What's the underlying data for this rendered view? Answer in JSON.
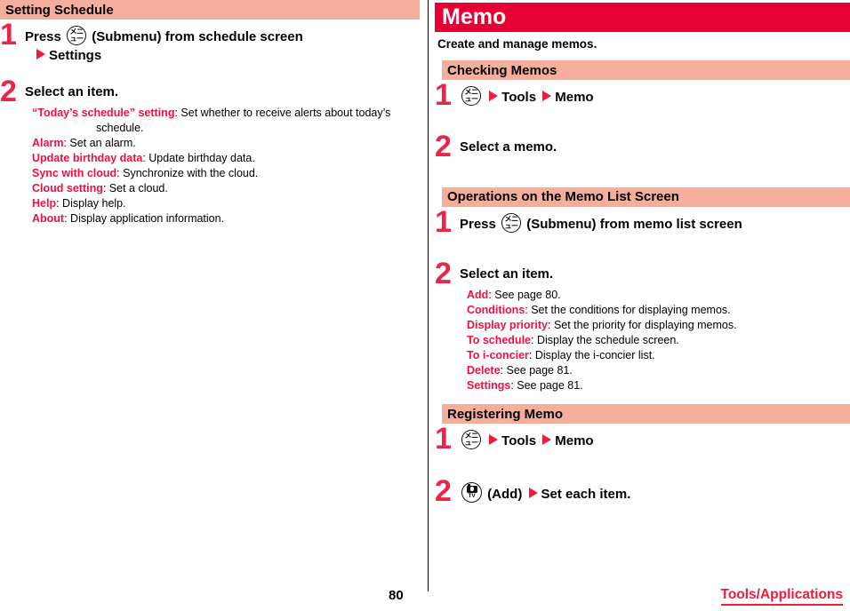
{
  "document": {
    "page_number": "80",
    "chapter_footer": "Tools/Applications"
  },
  "left_column": {
    "section_header": "Setting Schedule",
    "steps": [
      {
        "number": "1",
        "text_before_icon": "Press",
        "icon": "menu-key-icon",
        "icon_glyph": "メニュー",
        "text_after_icon": "(Submenu) from schedule screen",
        "sub_line_marker": "triangle-right-icon",
        "sub_line": "Settings"
      },
      {
        "number": "2",
        "title": "Select an item.",
        "items": [
          {
            "term": "“Today’s schedule” setting",
            "desc": ": Set whether to receive alerts about today’s",
            "cont": "schedule."
          },
          {
            "term": "Alarm",
            "desc": ": Set an alarm.",
            "cont": ""
          },
          {
            "term": "Update birthday data",
            "desc": ": Update birthday data.",
            "cont": ""
          },
          {
            "term": "Sync with cloud",
            "desc": ": Synchronize with the cloud.",
            "cont": ""
          },
          {
            "term": "Cloud setting",
            "desc": ": Set a cloud.",
            "cont": ""
          },
          {
            "term": "Help",
            "desc": ": Display help.",
            "cont": ""
          },
          {
            "term": "About",
            "desc": ": Display application information.",
            "cont": ""
          }
        ]
      }
    ]
  },
  "right_column": {
    "chapter_title": "Memo",
    "chapter_description": "Create and manage memos.",
    "sections": [
      {
        "header": "Checking Memos",
        "steps": [
          {
            "number": "1",
            "icon": "menu-key-icon",
            "icon_glyph": "メニュー",
            "nav_1": "Tools",
            "nav_2": "Memo"
          },
          {
            "number": "2",
            "title": "Select a memo."
          }
        ]
      },
      {
        "header": "Operations on the Memo List Screen",
        "steps": [
          {
            "number": "1",
            "text_before_icon": "Press",
            "icon": "menu-key-icon",
            "icon_glyph": "メニュー",
            "text_after_icon": "(Submenu) from memo list screen"
          },
          {
            "number": "2",
            "title": "Select an item.",
            "items": [
              {
                "term": "Add",
                "desc": ": See page 80."
              },
              {
                "term": "Conditions",
                "desc": ": Set the conditions for displaying memos."
              },
              {
                "term": "Display priority",
                "desc": ": Set the priority for displaying memos."
              },
              {
                "term": "To schedule",
                "desc": ": Display the schedule screen."
              },
              {
                "term": "To i-concier",
                "desc": ": Display the i-concier list."
              },
              {
                "term": "Delete",
                "desc": ": See page 81."
              },
              {
                "term": "Settings",
                "desc": ": See page 81."
              }
            ]
          }
        ]
      },
      {
        "header": "Registering Memo",
        "steps": [
          {
            "number": "1",
            "icon": "menu-key-icon",
            "icon_glyph": "メニュー",
            "nav_1": "Tools",
            "nav_2": "Memo"
          },
          {
            "number": "2",
            "icon": "camera-tv-key-icon",
            "icon_label": "TV",
            "text_after_icon": "(Add)",
            "nav_1": "Set each item."
          }
        ]
      }
    ]
  },
  "colors": {
    "chapter_bar": "#E60033",
    "section_bar": "#F6AE9C",
    "accent_red": "#EE1B3C",
    "term_red": "#F01040"
  }
}
